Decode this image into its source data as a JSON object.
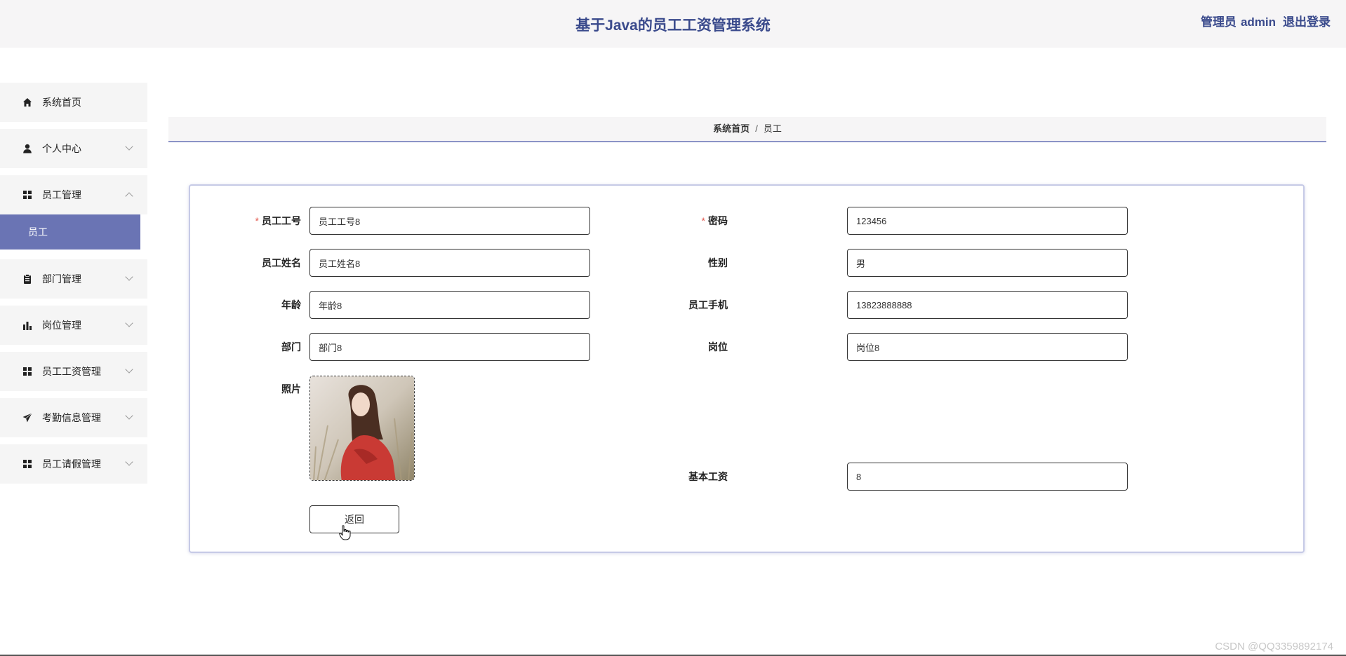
{
  "header": {
    "title": "基于Java的员工工资管理系统",
    "user_role": "管理员",
    "user_name": "admin",
    "logout": "退出登录"
  },
  "sidebar": {
    "items": [
      {
        "label": "系统首页",
        "icon": "home-icon"
      },
      {
        "label": "个人中心",
        "icon": "person-icon"
      },
      {
        "label": "员工管理",
        "icon": "grid-icon",
        "expanded": true,
        "sub": "员工"
      },
      {
        "label": "部门管理",
        "icon": "clipboard-icon"
      },
      {
        "label": "岗位管理",
        "icon": "bar-chart-icon"
      },
      {
        "label": "员工工资管理",
        "icon": "grid-icon"
      },
      {
        "label": "考勤信息管理",
        "icon": "send-icon"
      },
      {
        "label": "员工请假管理",
        "icon": "grid-icon"
      }
    ]
  },
  "breadcrumb": {
    "home": "系统首页",
    "separator": "/",
    "current": "员工"
  },
  "form": {
    "required_mark": "*",
    "employee_id": {
      "label": "员工工号",
      "value": "员工工号8"
    },
    "employee_name": {
      "label": "员工姓名",
      "value": "员工姓名8"
    },
    "age": {
      "label": "年龄",
      "value": "年龄8"
    },
    "department": {
      "label": "部门",
      "value": "部门8"
    },
    "photo": {
      "label": "照片"
    },
    "password": {
      "label": "密码",
      "value": "123456"
    },
    "gender": {
      "label": "性别",
      "value": "男"
    },
    "phone": {
      "label": "员工手机",
      "value": "13823888888"
    },
    "position": {
      "label": "岗位",
      "value": "岗位8"
    },
    "base_salary": {
      "label": "基本工资",
      "value": "8"
    },
    "back_button": "返回"
  },
  "watermark": "CSDN @QQ3359892174",
  "colors": {
    "accent": "#6a74b4",
    "title": "#3a4a8c",
    "required": "#e2574c"
  }
}
